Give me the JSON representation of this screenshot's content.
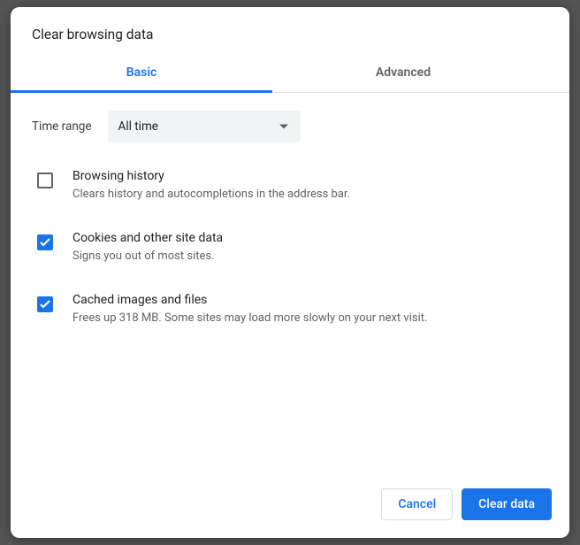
{
  "dialog": {
    "title": "Clear browsing data",
    "tabs": {
      "basic": "Basic",
      "advanced": "Advanced"
    },
    "time_range": {
      "label": "Time range",
      "selected": "All time"
    },
    "options": [
      {
        "id": "browsing-history",
        "checked": false,
        "title": "Browsing history",
        "description": "Clears history and autocompletions in the address bar."
      },
      {
        "id": "cookies",
        "checked": true,
        "title": "Cookies and other site data",
        "description": "Signs you out of most sites."
      },
      {
        "id": "cache",
        "checked": true,
        "title": "Cached images and files",
        "description": "Frees up 318 MB. Some sites may load more slowly on your next visit."
      }
    ],
    "buttons": {
      "cancel": "Cancel",
      "confirm": "Clear data"
    }
  }
}
